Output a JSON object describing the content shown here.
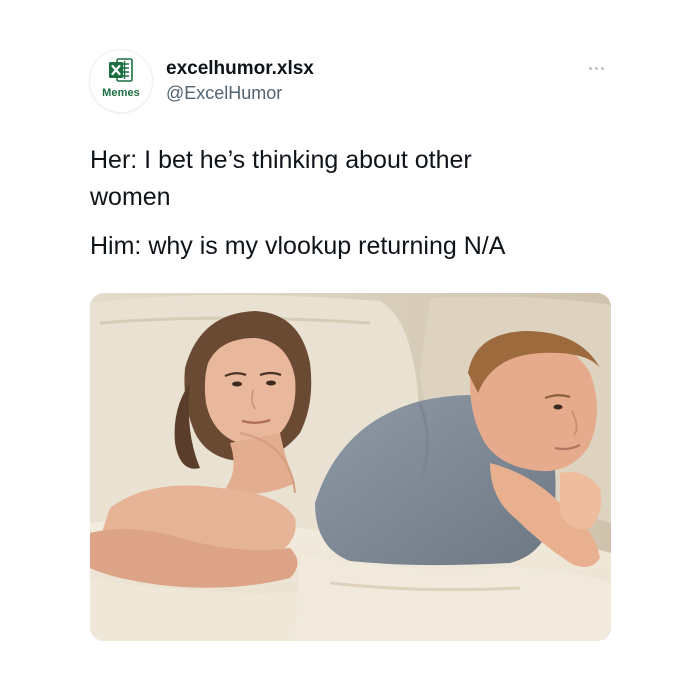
{
  "author": {
    "display_name": "excelhumor.xlsx",
    "handle": "@ExcelHumor",
    "avatar_badge": "Memes",
    "avatar_icon": "excel-logo-icon",
    "brand_color": "#1d6f42"
  },
  "actions": {
    "more_icon": "more-options-icon"
  },
  "tweet": {
    "line_1": "Her: I bet he’s thinking about other",
    "line_2": "women",
    "line_3": "Him: why is my vlookup returning N/A"
  },
  "media": {
    "description_icon": "meme-photo",
    "alt": "Couple lying in bed, woman looking away suspiciously, man staring thoughtfully"
  }
}
